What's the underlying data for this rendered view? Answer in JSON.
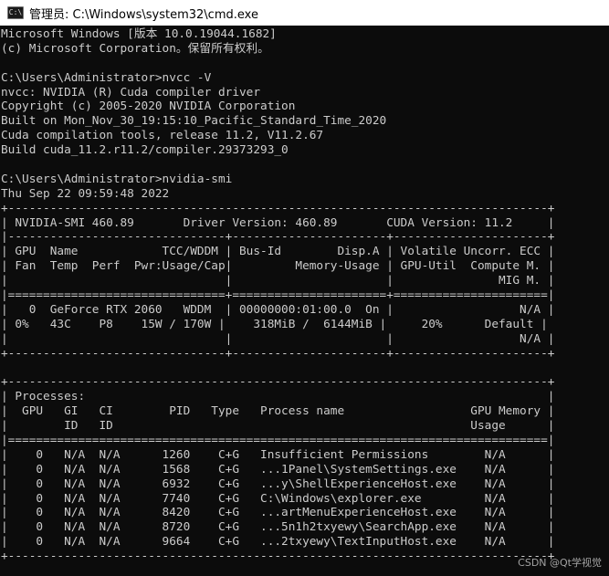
{
  "window": {
    "title": "管理员: C:\\Windows\\system32\\cmd.exe",
    "icon_text": "C:\\"
  },
  "console": {
    "lines": [
      "Microsoft Windows [版本 10.0.19044.1682]",
      "(c) Microsoft Corporation。保留所有权利。",
      "",
      "C:\\Users\\Administrator>nvcc -V",
      "nvcc: NVIDIA (R) Cuda compiler driver",
      "Copyright (c) 2005-2020 NVIDIA Corporation",
      "Built on Mon_Nov_30_19:15:10_Pacific_Standard_Time_2020",
      "Cuda compilation tools, release 11.2, V11.2.67",
      "Build cuda_11.2.r11.2/compiler.29373293_0",
      "",
      "C:\\Users\\Administrator>nvidia-smi",
      "Thu Sep 22 09:59:48 2022",
      "+-----------------------------------------------------------------------------+",
      "| NVIDIA-SMI 460.89       Driver Version: 460.89       CUDA Version: 11.2     |",
      "|-------------------------------+----------------------+----------------------+",
      "| GPU  Name            TCC/WDDM | Bus-Id        Disp.A | Volatile Uncorr. ECC |",
      "| Fan  Temp  Perf  Pwr:Usage/Cap|         Memory-Usage | GPU-Util  Compute M. |",
      "|                               |                      |               MIG M. |",
      "|===============================+======================+======================|",
      "|   0  GeForce RTX 2060   WDDM  | 00000000:01:00.0  On |                  N/A |",
      "| 0%   43C    P8    15W / 170W |    318MiB /  6144MiB |     20%      Default |",
      "|                               |                      |                  N/A |",
      "+-------------------------------+----------------------+----------------------+",
      "",
      "+-----------------------------------------------------------------------------+",
      "| Processes:                                                                  |",
      "|  GPU   GI   CI        PID   Type   Process name                  GPU Memory |",
      "|        ID   ID                                                   Usage      |",
      "|=============================================================================|",
      "|    0   N/A  N/A      1260    C+G   Insufficient Permissions        N/A      |",
      "|    0   N/A  N/A      1568    C+G   ...1Panel\\SystemSettings.exe    N/A      |",
      "|    0   N/A  N/A      6932    C+G   ...y\\ShellExperienceHost.exe    N/A      |",
      "|    0   N/A  N/A      7740    C+G   C:\\Windows\\explorer.exe         N/A      |",
      "|    0   N/A  N/A      8420    C+G   ...artMenuExperienceHost.exe    N/A      |",
      "|    0   N/A  N/A      8720    C+G   ...5n1h2txyewy\\SearchApp.exe    N/A      |",
      "|    0   N/A  N/A      9664    C+G   ...2txyewy\\TextInputHost.exe    N/A      |",
      "+-----------------------------------------------------------------------------+"
    ]
  },
  "watermark": "CSDN @Qt学视觉",
  "colors": {
    "background": "#0c0c0c",
    "text": "#cccccc",
    "titlebar": "#ffffff"
  }
}
